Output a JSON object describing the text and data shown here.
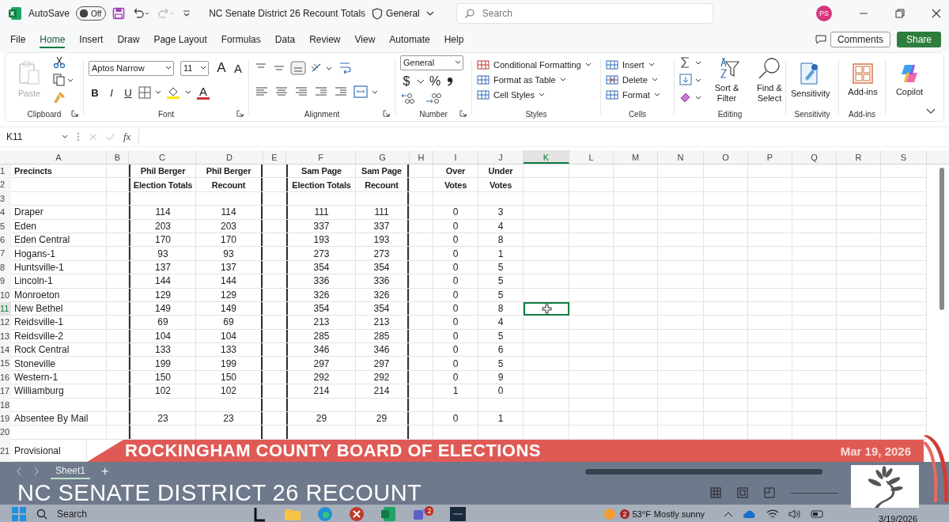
{
  "titlebar": {
    "autosave_label": "AutoSave",
    "autosave": {
      "label": "Off",
      "on": false
    },
    "document_title": "NC Senate District 26 Recount Totals",
    "sensitivity_label": "General",
    "search": {
      "placeholder": "Search"
    },
    "avatar": "PS"
  },
  "menu_tabs": [
    {
      "label": "File",
      "selected": false
    },
    {
      "label": "Home",
      "selected": true
    },
    {
      "label": "Insert",
      "selected": false
    },
    {
      "label": "Draw",
      "selected": false
    },
    {
      "label": "Page Layout",
      "selected": false
    },
    {
      "label": "Formulas",
      "selected": false
    },
    {
      "label": "Data",
      "selected": false
    },
    {
      "label": "Review",
      "selected": false
    },
    {
      "label": "View",
      "selected": false
    },
    {
      "label": "Automate",
      "selected": false
    },
    {
      "label": "Help",
      "selected": false
    }
  ],
  "comments_button": "Comments",
  "share_button": "Share",
  "ribbon": [
    {
      "kind": "clipboard",
      "name": "Clipboard",
      "paste": "Paste"
    },
    {
      "kind": "font",
      "name": "Font",
      "font": "Aptos Narrow",
      "size": "11",
      "grow": "A",
      "shrink": "A",
      "bold": "B",
      "italic": "I",
      "underline": "U",
      "font_color_glyph": "A"
    },
    {
      "kind": "alignment",
      "name": "Alignment"
    },
    {
      "kind": "number",
      "name": "Number",
      "format": "General",
      "currency": "$",
      "percent": "%"
    },
    {
      "kind": "styles",
      "name": "Styles",
      "items": [
        "Conditional Formatting",
        "Format as Table",
        "Cell Styles"
      ]
    },
    {
      "kind": "cells",
      "name": "Cells",
      "items": [
        "Insert",
        "Delete",
        "Format"
      ]
    },
    {
      "kind": "editing",
      "name": "Editing",
      "sort": "Sort & Filter",
      "find": "Find & Select"
    },
    {
      "kind": "sensitivity",
      "name": "Sensitivity",
      "button": "Sensitivity"
    },
    {
      "kind": "addins",
      "name": "Add-ins",
      "button": "Add-ins"
    },
    {
      "kind": "copilot",
      "button": "Copilot"
    }
  ],
  "formula_bar": {
    "name_box": "K11",
    "fx": "fx"
  },
  "sheet": {
    "columns": [
      {
        "label": "A",
        "selected": false
      },
      {
        "label": "B",
        "selected": false
      },
      {
        "label": "C",
        "selected": false
      },
      {
        "label": "D",
        "selected": false
      },
      {
        "label": "E",
        "selected": false
      },
      {
        "label": "F",
        "selected": false
      },
      {
        "label": "G",
        "selected": false
      },
      {
        "label": "H",
        "selected": false
      },
      {
        "label": "I",
        "selected": false
      },
      {
        "label": "J",
        "selected": false
      },
      {
        "label": "K",
        "selected": true
      },
      {
        "label": "L",
        "selected": false
      },
      {
        "label": "M",
        "selected": false
      },
      {
        "label": "N",
        "selected": false
      },
      {
        "label": "O",
        "selected": false
      },
      {
        "label": "P",
        "selected": false
      },
      {
        "label": "Q",
        "selected": false
      },
      {
        "label": "R",
        "selected": false
      },
      {
        "label": "S",
        "selected": false
      }
    ],
    "rows": [
      {
        "number": "1",
        "kind": "header",
        "selected": false,
        "cells": {
          "A": "Precincts",
          "C": "Phil Berger",
          "D": "Phil Berger",
          "F": "Sam Page",
          "G": "Sam Page",
          "I": "Over",
          "J": "Under"
        }
      },
      {
        "number": "2",
        "kind": "header",
        "selected": false,
        "cells": {
          "C": "Election Totals",
          "D": "Recount",
          "F": "Election Totals",
          "G": "Recount",
          "I": "Votes",
          "J": "Votes"
        }
      },
      {
        "number": "3",
        "kind": "data",
        "selected": false,
        "cells": {}
      },
      {
        "number": "4",
        "kind": "data",
        "selected": false,
        "cells": {
          "A": "Draper",
          "C": "114",
          "D": "114",
          "F": "111",
          "G": "111",
          "I": "0",
          "J": "3"
        }
      },
      {
        "number": "5",
        "kind": "data",
        "selected": false,
        "cells": {
          "A": "Eden",
          "C": "203",
          "D": "203",
          "F": "337",
          "G": "337",
          "I": "0",
          "J": "4"
        }
      },
      {
        "number": "6",
        "kind": "data",
        "selected": false,
        "cells": {
          "A": "Eden Central",
          "C": "170",
          "D": "170",
          "F": "193",
          "G": "193",
          "I": "0",
          "J": "8"
        }
      },
      {
        "number": "7",
        "kind": "data",
        "selected": false,
        "cells": {
          "A": "Hogans-1",
          "C": "93",
          "D": "93",
          "F": "273",
          "G": "273",
          "I": "0",
          "J": "1"
        }
      },
      {
        "number": "8",
        "kind": "data",
        "selected": false,
        "cells": {
          "A": "Huntsville-1",
          "C": "137",
          "D": "137",
          "F": "354",
          "G": "354",
          "I": "0",
          "J": "5"
        }
      },
      {
        "number": "9",
        "kind": "data",
        "selected": false,
        "cells": {
          "A": "Lincoln-1",
          "C": "144",
          "D": "144",
          "F": "336",
          "G": "336",
          "I": "0",
          "J": "5"
        }
      },
      {
        "number": "10",
        "kind": "data",
        "selected": false,
        "cells": {
          "A": "Monroeton",
          "C": "129",
          "D": "129",
          "F": "326",
          "G": "326",
          "I": "0",
          "J": "5"
        }
      },
      {
        "number": "11",
        "kind": "data",
        "selected": true,
        "cells": {
          "A": "New Bethel",
          "C": "149",
          "D": "149",
          "F": "354",
          "G": "354",
          "I": "0",
          "J": "8"
        }
      },
      {
        "number": "12",
        "kind": "data",
        "selected": false,
        "cells": {
          "A": "Reidsville-1",
          "C": "69",
          "D": "69",
          "F": "213",
          "G": "213",
          "I": "0",
          "J": "4"
        }
      },
      {
        "number": "13",
        "kind": "data",
        "selected": false,
        "cells": {
          "A": "Reidsville-2",
          "C": "104",
          "D": "104",
          "F": "285",
          "G": "285",
          "I": "0",
          "J": "5"
        }
      },
      {
        "number": "14",
        "kind": "data",
        "selected": false,
        "cells": {
          "A": "Rock Central",
          "C": "133",
          "D": "133",
          "F": "346",
          "G": "346",
          "I": "0",
          "J": "6"
        }
      },
      {
        "number": "15",
        "kind": "data",
        "selected": false,
        "cells": {
          "A": "Stoneville",
          "C": "199",
          "D": "199",
          "F": "297",
          "G": "297",
          "I": "0",
          "J": "5"
        }
      },
      {
        "number": "16",
        "kind": "data",
        "selected": false,
        "cells": {
          "A": "Western-1",
          "C": "150",
          "D": "150",
          "F": "292",
          "G": "292",
          "I": "0",
          "J": "9"
        }
      },
      {
        "number": "17",
        "kind": "data",
        "selected": false,
        "cells": {
          "A": "Williamburg",
          "C": "102",
          "D": "102",
          "F": "214",
          "G": "214",
          "I": "1",
          "J": "0"
        }
      },
      {
        "number": "18",
        "kind": "data",
        "selected": false,
        "cells": {}
      },
      {
        "number": "19",
        "kind": "data",
        "selected": false,
        "cells": {
          "A": "Absentee By Mail",
          "C": "23",
          "D": "23",
          "F": "29",
          "G": "29",
          "I": "0",
          "J": "1"
        }
      },
      {
        "number": "20",
        "kind": "data",
        "selected": false,
        "cells": {}
      },
      {
        "number": "21",
        "kind": "data",
        "selected": false,
        "cells": {
          "A": "Provisional"
        }
      }
    ]
  },
  "sheet_tabs": [
    {
      "label": "Sheet1",
      "selected": true
    }
  ],
  "add_sheet": "+",
  "taskbar": {
    "search": "Search",
    "weather_badge": "2",
    "temperature": "53°F",
    "weather": "Mostly sunny",
    "app_badge": "2",
    "date": "3/19/2026"
  },
  "broadcast": {
    "banner": "ROCKINGHAM COUNTY BOARD OF ELECTIONS",
    "date": "Mar 19, 2026",
    "headline": "NC SENATE DISTRICT 26 RECOUNT"
  }
}
